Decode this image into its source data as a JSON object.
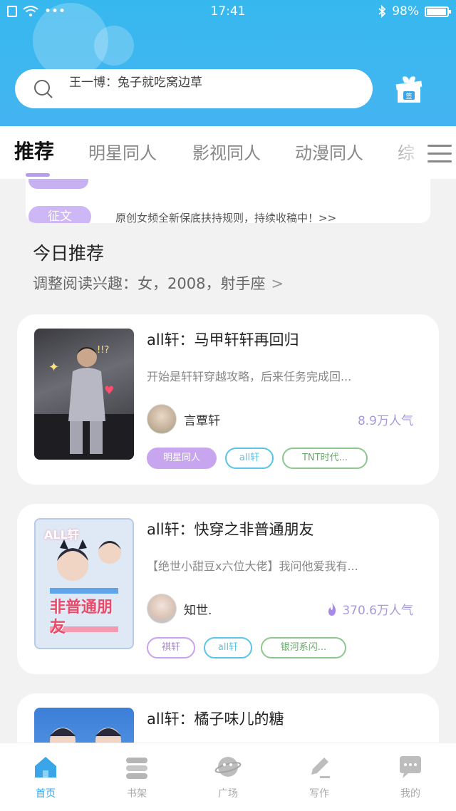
{
  "status_bar": {
    "time": "17:41",
    "battery": "98%"
  },
  "search": {
    "text": "王一博：兔子就吃窝边草"
  },
  "tabs": [
    {
      "label": "推荐",
      "active": true
    },
    {
      "label": "明星同人"
    },
    {
      "label": "影视同人"
    },
    {
      "label": "动漫同人"
    },
    {
      "label": "综"
    }
  ],
  "notice": {
    "tag": "征文",
    "message": "原创女频全新保底扶持规则，持续收稿中！>>"
  },
  "section": {
    "title": "今日推荐",
    "subtitle": "调整阅读兴趣：女，2008，射手座"
  },
  "books": [
    {
      "title": "all轩：马甲轩轩再回归",
      "desc": "开始是轩轩穿越攻略，后来任务完成回...",
      "author": "言覃轩",
      "popularity": "8.9万人气",
      "tags": [
        "明星同人",
        "all轩",
        "TNT时代..."
      ]
    },
    {
      "title": "all轩：快穿之非普通朋友",
      "desc": "【绝世小甜豆x六位大佬】我问他爱我有...",
      "author": "知世.",
      "popularity": "370.6万人气",
      "cover_text": "非普通朋友",
      "cover_badge": "ALL轩",
      "tags": [
        "祺轩",
        "all轩",
        "银河系闪..."
      ]
    },
    {
      "title": "all轩：橘子味儿的糖"
    }
  ],
  "bottom_nav": [
    {
      "label": "首页",
      "icon": "home-icon",
      "active": true
    },
    {
      "label": "书架",
      "icon": "bookshelf-icon"
    },
    {
      "label": "广场",
      "icon": "planet-icon"
    },
    {
      "label": "写作",
      "icon": "pen-icon"
    },
    {
      "label": "我的",
      "icon": "chat-bubble-icon"
    }
  ],
  "colors": {
    "header": "#3db7ef",
    "accent_purple": "#c8a6ef",
    "active_nav": "#3aa6e8"
  }
}
